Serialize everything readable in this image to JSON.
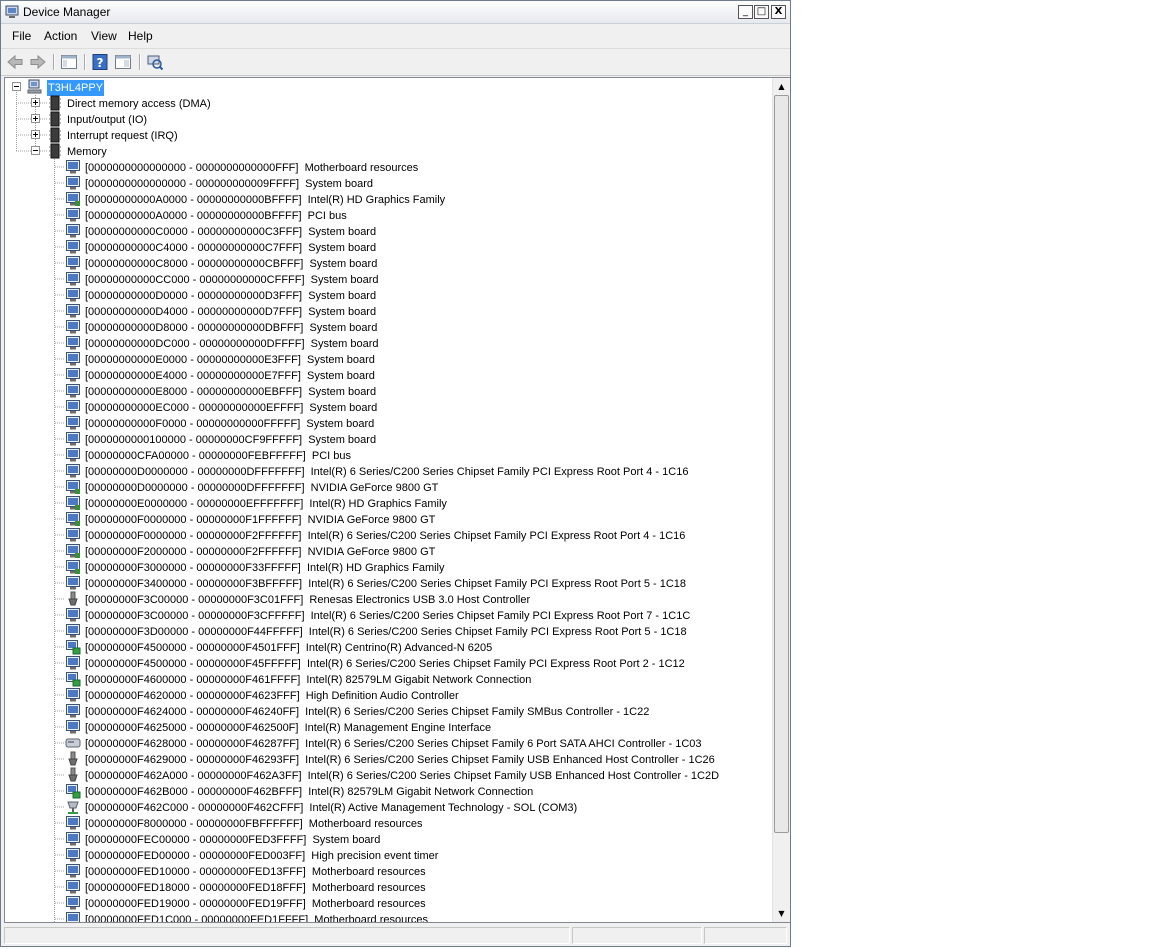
{
  "window": {
    "title": "Device Manager",
    "buttons": {
      "minimize": "_",
      "maximize": "□",
      "close": "X"
    }
  },
  "menu": [
    "File",
    "Action",
    "View",
    "Help"
  ],
  "toolbar": [
    {
      "icon": "back-arrow-icon"
    },
    {
      "icon": "forward-arrow-icon"
    },
    {
      "icon": "show-hide-console-tree-icon"
    },
    {
      "icon": "help-icon"
    },
    {
      "icon": "properties-pane-icon"
    },
    {
      "icon": "scan-hardware-icon"
    }
  ],
  "colors": {
    "selection": "#3399ff",
    "titlebar": "#e6e9ee",
    "window_bg": "#f0f0f0"
  },
  "tree": {
    "root": "T3HL4PPY",
    "categories": [
      {
        "label": "Direct memory access (DMA)",
        "expanded": false
      },
      {
        "label": "Input/output (IO)",
        "expanded": false
      },
      {
        "label": "Interrupt request (IRQ)",
        "expanded": false
      },
      {
        "label": "Memory",
        "expanded": true
      }
    ],
    "memory_items": [
      {
        "range": "[0000000000000000 - 0000000000000FFF]",
        "device": "Motherboard resources",
        "icon": "monitor"
      },
      {
        "range": "[0000000000000000 - 000000000009FFFF]",
        "device": "System board",
        "icon": "monitor"
      },
      {
        "range": "[00000000000A0000 - 00000000000BFFFF]",
        "device": "Intel(R) HD Graphics Family",
        "icon": "display"
      },
      {
        "range": "[00000000000A0000 - 00000000000BFFFF]",
        "device": "PCI bus",
        "icon": "monitor"
      },
      {
        "range": "[00000000000C0000 - 00000000000C3FFF]",
        "device": "System board",
        "icon": "monitor"
      },
      {
        "range": "[00000000000C4000 - 00000000000C7FFF]",
        "device": "System board",
        "icon": "monitor"
      },
      {
        "range": "[00000000000C8000 - 00000000000CBFFF]",
        "device": "System board",
        "icon": "monitor"
      },
      {
        "range": "[00000000000CC000 - 00000000000CFFFF]",
        "device": "System board",
        "icon": "monitor"
      },
      {
        "range": "[00000000000D0000 - 00000000000D3FFF]",
        "device": "System board",
        "icon": "monitor"
      },
      {
        "range": "[00000000000D4000 - 00000000000D7FFF]",
        "device": "System board",
        "icon": "monitor"
      },
      {
        "range": "[00000000000D8000 - 00000000000DBFFF]",
        "device": "System board",
        "icon": "monitor"
      },
      {
        "range": "[00000000000DC000 - 00000000000DFFFF]",
        "device": "System board",
        "icon": "monitor"
      },
      {
        "range": "[00000000000E0000 - 00000000000E3FFF]",
        "device": "System board",
        "icon": "monitor"
      },
      {
        "range": "[00000000000E4000 - 00000000000E7FFF]",
        "device": "System board",
        "icon": "monitor"
      },
      {
        "range": "[00000000000E8000 - 00000000000EBFFF]",
        "device": "System board",
        "icon": "monitor"
      },
      {
        "range": "[00000000000EC000 - 00000000000EFFFF]",
        "device": "System board",
        "icon": "monitor"
      },
      {
        "range": "[00000000000F0000 - 00000000000FFFFF]",
        "device": "System board",
        "icon": "monitor"
      },
      {
        "range": "[0000000000100000 - 00000000CF9FFFFF]",
        "device": "System board",
        "icon": "monitor"
      },
      {
        "range": "[00000000CFA00000 - 00000000FEBFFFFF]",
        "device": "PCI bus",
        "icon": "monitor"
      },
      {
        "range": "[00000000D0000000 - 00000000DFFFFFFF]",
        "device": "Intel(R) 6 Series/C200 Series Chipset Family PCI Express Root Port 4 - 1C16",
        "icon": "monitor"
      },
      {
        "range": "[00000000D0000000 - 00000000DFFFFFFF]",
        "device": "NVIDIA GeForce 9800 GT",
        "icon": "display"
      },
      {
        "range": "[00000000E0000000 - 00000000EFFFFFFF]",
        "device": "Intel(R) HD Graphics Family",
        "icon": "display"
      },
      {
        "range": "[00000000F0000000 - 00000000F1FFFFFF]",
        "device": "NVIDIA GeForce 9800 GT",
        "icon": "display"
      },
      {
        "range": "[00000000F0000000 - 00000000F2FFFFFF]",
        "device": "Intel(R) 6 Series/C200 Series Chipset Family PCI Express Root Port 4 - 1C16",
        "icon": "monitor"
      },
      {
        "range": "[00000000F2000000 - 00000000F2FFFFFF]",
        "device": "NVIDIA GeForce 9800 GT",
        "icon": "display"
      },
      {
        "range": "[00000000F3000000 - 00000000F33FFFFF]",
        "device": "Intel(R) HD Graphics Family",
        "icon": "display"
      },
      {
        "range": "[00000000F3400000 - 00000000F3BFFFFF]",
        "device": "Intel(R) 6 Series/C200 Series Chipset Family PCI Express Root Port 5 - 1C18",
        "icon": "monitor"
      },
      {
        "range": "[00000000F3C00000 - 00000000F3C01FFF]",
        "device": "Renesas Electronics USB 3.0 Host Controller",
        "icon": "usb"
      },
      {
        "range": "[00000000F3C00000 - 00000000F3CFFFFF]",
        "device": "Intel(R) 6 Series/C200 Series Chipset Family PCI Express Root Port 7 - 1C1C",
        "icon": "monitor"
      },
      {
        "range": "[00000000F3D00000 - 00000000F44FFFFF]",
        "device": "Intel(R) 6 Series/C200 Series Chipset Family PCI Express Root Port 5 - 1C18",
        "icon": "monitor"
      },
      {
        "range": "[00000000F4500000 - 00000000F4501FFF]",
        "device": "Intel(R) Centrino(R) Advanced-N 6205",
        "icon": "network"
      },
      {
        "range": "[00000000F4500000 - 00000000F45FFFFF]",
        "device": "Intel(R) 6 Series/C200 Series Chipset Family PCI Express Root Port 2 - 1C12",
        "icon": "monitor"
      },
      {
        "range": "[00000000F4600000 - 00000000F461FFFF]",
        "device": "Intel(R) 82579LM Gigabit Network Connection",
        "icon": "network"
      },
      {
        "range": "[00000000F4620000 - 00000000F4623FFF]",
        "device": "High Definition Audio Controller",
        "icon": "monitor"
      },
      {
        "range": "[00000000F4624000 - 00000000F46240FF]",
        "device": "Intel(R) 6 Series/C200 Series Chipset Family SMBus Controller - 1C22",
        "icon": "monitor"
      },
      {
        "range": "[00000000F4625000 - 00000000F462500F]",
        "device": "Intel(R) Management Engine Interface",
        "icon": "monitor"
      },
      {
        "range": "[00000000F4628000 - 00000000F46287FF]",
        "device": "Intel(R) 6 Series/C200 Series Chipset Family 6 Port SATA AHCI Controller - 1C03",
        "icon": "storage"
      },
      {
        "range": "[00000000F4629000 - 00000000F46293FF]",
        "device": "Intel(R) 6 Series/C200 Series Chipset Family USB Enhanced Host Controller - 1C26",
        "icon": "usb"
      },
      {
        "range": "[00000000F462A000 - 00000000F462A3FF]",
        "device": "Intel(R) 6 Series/C200 Series Chipset Family USB Enhanced Host Controller - 1C2D",
        "icon": "usb"
      },
      {
        "range": "[00000000F462B000 - 00000000F462BFFF]",
        "device": "Intel(R) 82579LM Gigabit Network Connection",
        "icon": "network"
      },
      {
        "range": "[00000000F462C000 - 00000000F462CFFF]",
        "device": "Intel(R) Active Management Technology - SOL (COM3)",
        "icon": "port"
      },
      {
        "range": "[00000000F8000000 - 00000000FBFFFFFF]",
        "device": "Motherboard resources",
        "icon": "monitor"
      },
      {
        "range": "[00000000FEC00000 - 00000000FED3FFFF]",
        "device": "System board",
        "icon": "monitor"
      },
      {
        "range": "[00000000FED00000 - 00000000FED003FF]",
        "device": "High precision event timer",
        "icon": "monitor"
      },
      {
        "range": "[00000000FED10000 - 00000000FED13FFF]",
        "device": "Motherboard resources",
        "icon": "monitor"
      },
      {
        "range": "[00000000FED18000 - 00000000FED18FFF]",
        "device": "Motherboard resources",
        "icon": "monitor"
      },
      {
        "range": "[00000000FED19000 - 00000000FED19FFF]",
        "device": "Motherboard resources",
        "icon": "monitor"
      },
      {
        "range": "[00000000FED1C000 - 00000000FED1FFFF]",
        "device": "Motherboard resources",
        "icon": "monitor"
      }
    ]
  }
}
